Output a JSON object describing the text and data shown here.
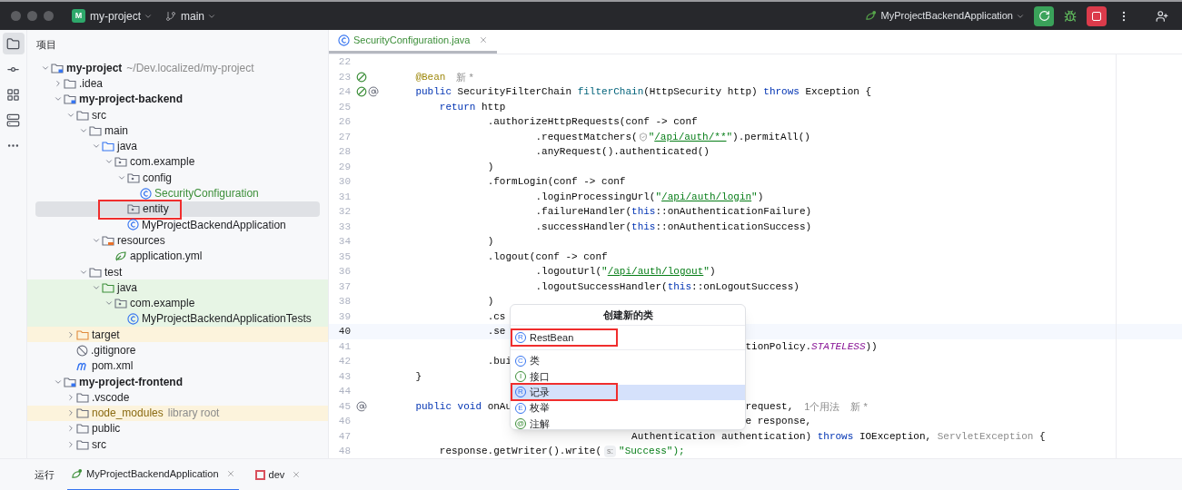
{
  "titlebar": {
    "project_badge": "M",
    "project": "my-project",
    "branch": "main",
    "run_config": "MyProjectBackendApplication"
  },
  "toolstrip": [
    {
      "kind": "project",
      "selected": true
    },
    {
      "kind": "commit",
      "selected": false
    },
    {
      "kind": "structure",
      "selected": false
    },
    {
      "kind": "services",
      "selected": false
    },
    {
      "kind": "more",
      "selected": false
    }
  ],
  "project": {
    "title": "项目",
    "tree": [
      {
        "label": "my-project",
        "kind": "module",
        "note": "~/Dev.localized/my-project",
        "expanded": true,
        "selected": false,
        "children": [
          {
            "label": ".idea",
            "kind": "folder",
            "expanded": false,
            "selected": false
          },
          {
            "label": "my-project-backend",
            "kind": "module",
            "expanded": true,
            "selected": false,
            "children": [
              {
                "label": "src",
                "kind": "folder",
                "expanded": true,
                "selected": false,
                "children": [
                  {
                    "label": "main",
                    "kind": "folder",
                    "expanded": true,
                    "selected": false,
                    "children": [
                      {
                        "label": "java",
                        "kind": "source-root",
                        "expanded": true,
                        "selected": false,
                        "children": [
                          {
                            "label": "com.example",
                            "kind": "package",
                            "expanded": true,
                            "selected": false,
                            "children": [
                              {
                                "label": "config",
                                "kind": "package",
                                "expanded": true,
                                "selected": false,
                                "children": [
                                  {
                                    "label": "SecurityConfiguration",
                                    "kind": "class",
                                    "color": "#3d8f3a",
                                    "selected": false
                                  }
                                ]
                              },
                              {
                                "label": "entity",
                                "kind": "package",
                                "selected": true,
                                "annotated": true
                              },
                              {
                                "label": "MyProjectBackendApplication",
                                "kind": "app-class",
                                "selected": false
                              }
                            ]
                          }
                        ]
                      },
                      {
                        "label": "resources",
                        "kind": "resources-root",
                        "expanded": true,
                        "selected": false,
                        "children": [
                          {
                            "label": "application.yml",
                            "kind": "yml",
                            "selected": false
                          }
                        ]
                      }
                    ]
                  },
                  {
                    "label": "test",
                    "kind": "folder",
                    "expanded": true,
                    "selected": false,
                    "children": [
                      {
                        "label": "java",
                        "kind": "test-root",
                        "expanded": true,
                        "selected": false,
                        "test_source": true,
                        "children": [
                          {
                            "label": "com.example",
                            "kind": "package",
                            "expanded": true,
                            "selected": false,
                            "test_source": true,
                            "children": [
                              {
                                "label": "MyProjectBackendApplicationTests",
                                "kind": "class",
                                "selected": false,
                                "test_source": true
                              }
                            ]
                          }
                        ]
                      }
                    ]
                  }
                ]
              },
              {
                "label": "target",
                "kind": "excluded",
                "expanded": false,
                "selected": false,
                "excluded": true
              },
              {
                "label": ".gitignore",
                "kind": "gitignore",
                "selected": false
              },
              {
                "label": "pom.xml",
                "kind": "maven",
                "selected": false
              }
            ]
          },
          {
            "label": "my-project-frontend",
            "kind": "module",
            "expanded": true,
            "selected": false,
            "children": [
              {
                "label": ".vscode",
                "kind": "folder",
                "expanded": false,
                "selected": false
              },
              {
                "label": "node_modules",
                "kind": "folder",
                "note": "library root",
                "color": "#8a6a12",
                "expanded": false,
                "selected": false,
                "excluded": true
              },
              {
                "label": "public",
                "kind": "folder",
                "expanded": false,
                "selected": false
              },
              {
                "label": "src",
                "kind": "folder",
                "expanded": false,
                "selected": false
              }
            ]
          }
        ]
      }
    ]
  },
  "editor": {
    "tab": {
      "label": "SecurityConfiguration.java",
      "color": "#3d8f3a",
      "selected": true
    },
    "lines": [
      {
        "number": "22",
        "current": false
      },
      {
        "number": "23",
        "current": false,
        "gutter": [
          {
            "kind": "bean"
          }
        ],
        "segments": [
          [
            {
              "kind": "ann",
              "text": "    @Bean"
            },
            {
              "kind": "hint",
              "text": "新 *"
            }
          ]
        ]
      },
      {
        "number": "24",
        "current": false,
        "gutter": [
          {
            "kind": "bean"
          },
          {
            "kind": "at"
          }
        ],
        "segments": [
          [
            {
              "kind": "kw",
              "text": "    public"
            },
            {
              "kind": "plain",
              "text": " SecurityFilterChain "
            },
            {
              "kind": "fn",
              "text": "filterChain"
            },
            {
              "kind": "plain",
              "text": "(HttpSecurity http) "
            },
            {
              "kind": "kw",
              "text": "throws"
            },
            {
              "kind": "plain",
              "text": " Exception {"
            }
          ]
        ]
      },
      {
        "number": "25",
        "current": false,
        "segments": [
          [
            {
              "kind": "kw",
              "text": "        return"
            },
            {
              "kind": "plain",
              "text": " http"
            }
          ]
        ]
      },
      {
        "number": "26",
        "current": false,
        "segments": [
          [
            {
              "kind": "plain",
              "text": "                .authorizeHttpRequests(conf -> conf"
            }
          ]
        ]
      },
      {
        "number": "27",
        "current": false,
        "segments": [
          [
            {
              "kind": "plain",
              "text": "                        .requestMatchers("
            },
            {
              "kind": "shield"
            },
            {
              "kind": "str",
              "text": "\""
            },
            {
              "kind": "url",
              "text": "/api/auth/**"
            },
            {
              "kind": "str",
              "text": "\""
            },
            {
              "kind": "plain",
              "text": ").permitAll()"
            }
          ]
        ]
      },
      {
        "number": "28",
        "current": false,
        "segments": [
          [
            {
              "kind": "plain",
              "text": "                        .anyRequest().authenticated()"
            }
          ]
        ]
      },
      {
        "number": "29",
        "current": false,
        "segments": [
          [
            {
              "kind": "plain",
              "text": "                )"
            }
          ]
        ]
      },
      {
        "number": "30",
        "current": false,
        "segments": [
          [
            {
              "kind": "plain",
              "text": "                .formLogin(conf -> conf"
            }
          ]
        ]
      },
      {
        "number": "31",
        "current": false,
        "segments": [
          [
            {
              "kind": "plain",
              "text": "                        .loginProcessingUrl("
            },
            {
              "kind": "str",
              "text": "\""
            },
            {
              "kind": "url",
              "text": "/api/auth/login"
            },
            {
              "kind": "str",
              "text": "\""
            },
            {
              "kind": "plain",
              "text": ")"
            }
          ]
        ]
      },
      {
        "number": "32",
        "current": false,
        "segments": [
          [
            {
              "kind": "plain",
              "text": "                        .failureHandler("
            },
            {
              "kind": "kw",
              "text": "this"
            },
            {
              "kind": "plain",
              "text": "::onAuthenticationFailure)"
            }
          ]
        ]
      },
      {
        "number": "33",
        "current": false,
        "segments": [
          [
            {
              "kind": "plain",
              "text": "                        .successHandler("
            },
            {
              "kind": "kw",
              "text": "this"
            },
            {
              "kind": "plain",
              "text": "::onAuthenticationSuccess)"
            }
          ]
        ]
      },
      {
        "number": "34",
        "current": false,
        "segments": [
          [
            {
              "kind": "plain",
              "text": "                )"
            }
          ]
        ]
      },
      {
        "number": "35",
        "current": false,
        "segments": [
          [
            {
              "kind": "plain",
              "text": "                .logout(conf -> conf"
            }
          ]
        ]
      },
      {
        "number": "36",
        "current": false,
        "segments": [
          [
            {
              "kind": "plain",
              "text": "                        .logoutUrl("
            },
            {
              "kind": "str",
              "text": "\""
            },
            {
              "kind": "url",
              "text": "/api/auth/logout"
            },
            {
              "kind": "str",
              "text": "\""
            },
            {
              "kind": "plain",
              "text": ")"
            }
          ]
        ]
      },
      {
        "number": "37",
        "current": false,
        "segments": [
          [
            {
              "kind": "plain",
              "text": "                        .logoutSuccessHandler("
            },
            {
              "kind": "kw",
              "text": "this"
            },
            {
              "kind": "plain",
              "text": "::onLogoutSuccess)"
            }
          ]
        ]
      },
      {
        "number": "38",
        "current": false,
        "segments": [
          [
            {
              "kind": "plain",
              "text": "                )"
            }
          ]
        ]
      },
      {
        "number": "39",
        "current": false,
        "segments": [
          [
            {
              "kind": "plain",
              "text": "                .cs"
            }
          ]
        ]
      },
      {
        "number": "40",
        "current": true,
        "segments": [
          [
            {
              "kind": "plain",
              "text": "                .se"
            }
          ]
        ]
      },
      {
        "number": "41",
        "current": false,
        "segments": [
          [
            {
              "kind": "plain",
              "text": "                                                           tionPolicy."
            },
            {
              "kind": "const",
              "text": "STATELESS"
            },
            {
              "kind": "plain",
              "text": "))"
            }
          ]
        ]
      },
      {
        "number": "42",
        "current": false,
        "segments": [
          [
            {
              "kind": "plain",
              "text": "                .bui"
            }
          ]
        ]
      },
      {
        "number": "43",
        "current": false,
        "segments": [
          [
            {
              "kind": "plain",
              "text": "    }"
            }
          ]
        ]
      },
      {
        "number": "44",
        "current": false
      },
      {
        "number": "45",
        "current": false,
        "gutter": [
          {
            "kind": "at"
          }
        ],
        "segments": [
          [
            {
              "kind": "kw",
              "text": "    public"
            },
            {
              "kind": "kw",
              "text": " void"
            },
            {
              "kind": "plain",
              "text": " onAu"
            }
          ],
          [
            {
              "kind": "plain",
              "text": "                                       request,"
            },
            {
              "kind": "hint",
              "text": "1个用法"
            },
            {
              "kind": "hint",
              "text": "新 *"
            }
          ]
        ]
      },
      {
        "number": "46",
        "current": false,
        "segments": [
          [
            {
              "kind": "plain",
              "text": "                                                           e response,"
            }
          ]
        ]
      },
      {
        "number": "47",
        "current": false,
        "segments": [
          [
            {
              "kind": "plain",
              "text": "                                        Authentication authentication) "
            },
            {
              "kind": "kw",
              "text": "throws"
            },
            {
              "kind": "plain",
              "text": " IOException, "
            },
            {
              "kind": "dim",
              "text": "ServletException"
            },
            {
              "kind": "plain",
              "text": " {"
            }
          ]
        ]
      },
      {
        "number": "48",
        "current": false,
        "segments": [
          [
            {
              "kind": "plain",
              "text": "        response.getWriter().write("
            },
            {
              "kind": "inlay",
              "text": "s:"
            },
            {
              "kind": "str",
              "text": "\"Success\");"
            }
          ]
        ]
      }
    ]
  },
  "popup": {
    "title": "创建新的类",
    "recent": [
      {
        "label": "RestBean",
        "icon": "R",
        "kind": "record",
        "selected": false,
        "annotated": true
      }
    ],
    "items": [
      {
        "label": "类",
        "icon": "C",
        "kind": "class",
        "selected": false
      },
      {
        "label": "接口",
        "icon": "I",
        "kind": "interface",
        "selected": false
      },
      {
        "label": "记录",
        "icon": "R",
        "kind": "record",
        "selected": true,
        "annotated": true
      },
      {
        "label": "枚举",
        "icon": "E",
        "kind": "enum",
        "selected": false
      },
      {
        "label": "注解",
        "icon": "@",
        "kind": "annotation",
        "selected": false
      }
    ]
  },
  "bottom": {
    "title": "运行",
    "tabs": [
      {
        "label": "MyProjectBackendApplication",
        "kind": "spring",
        "selected": true
      },
      {
        "label": "dev",
        "kind": "npm",
        "selected": false
      }
    ]
  }
}
